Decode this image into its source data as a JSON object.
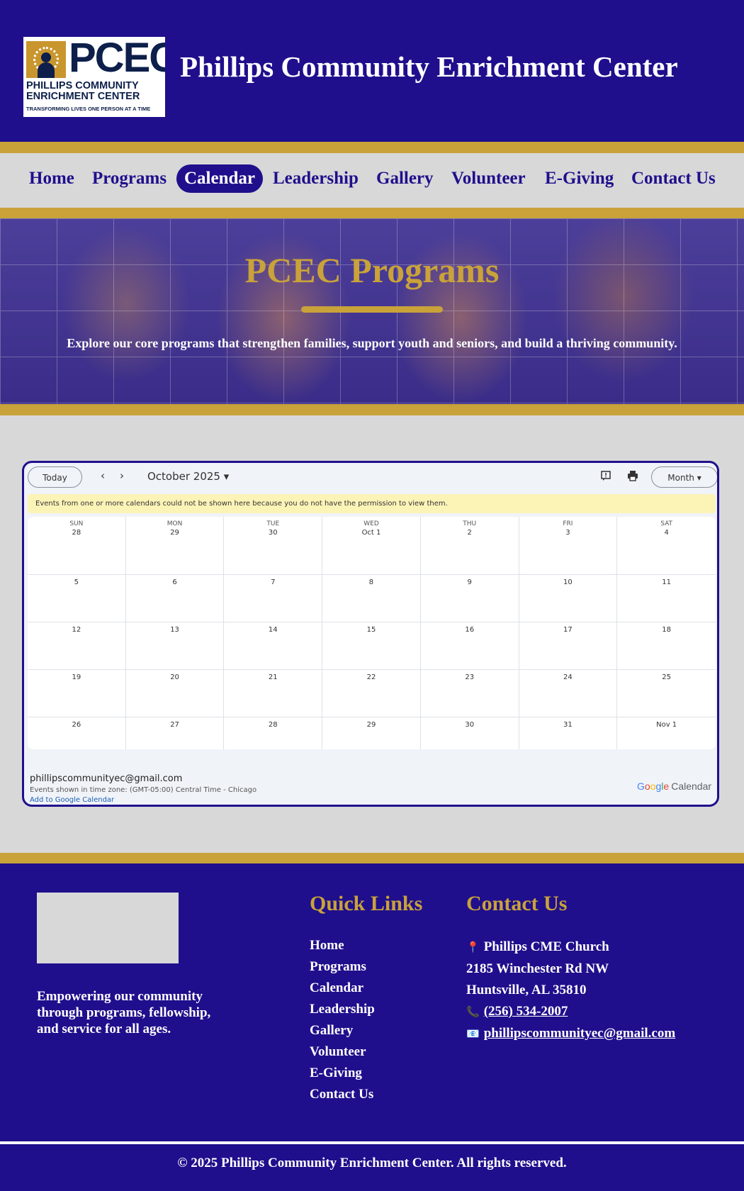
{
  "header": {
    "logo": {
      "big": "PCEC",
      "line1": "PHILLIPS COMMUNITY",
      "line2": "ENRICHMENT CENTER",
      "tagline": "TRANSFORMING LIVES ONE PERSON AT A TIME"
    },
    "title": "Phillips Community Enrichment Center"
  },
  "nav": {
    "items": [
      {
        "label": "Home"
      },
      {
        "label": "Programs"
      },
      {
        "label": "Calendar",
        "active": true
      },
      {
        "label": "Leadership"
      },
      {
        "label": "Gallery"
      },
      {
        "label": "Volunteer"
      },
      {
        "label": "E-Giving"
      },
      {
        "label": "Contact Us"
      }
    ]
  },
  "hero": {
    "title": "PCEC Programs",
    "subtitle": "Explore our core programs that strengthen families, support youth and seniors, and build a thriving community."
  },
  "calendar": {
    "today_label": "Today",
    "prev_icon": "‹",
    "next_icon": "›",
    "month_label": "October 2025 ▾",
    "view_label": "Month ▾",
    "warning": "Events from one or more calendars could not be shown here because you do not have the permission to view them.",
    "weekdays": [
      "SUN",
      "MON",
      "TUE",
      "WED",
      "THU",
      "FRI",
      "SAT"
    ],
    "dates": [
      "28",
      "29",
      "30",
      "Oct 1",
      "2",
      "3",
      "4",
      "5",
      "6",
      "7",
      "8",
      "9",
      "10",
      "11",
      "12",
      "13",
      "14",
      "15",
      "16",
      "17",
      "18",
      "19",
      "20",
      "21",
      "22",
      "23",
      "24",
      "25",
      "26",
      "27",
      "28",
      "29",
      "30",
      "31",
      "Nov 1"
    ],
    "owner_email": "phillipscommunityec@gmail.com",
    "timezone": "Events shown in time zone: (GMT-05:00) Central Time - Chicago",
    "add_link": "Add to Google Calendar",
    "brand_google": [
      "G",
      "o",
      "o",
      "g",
      "l",
      "e"
    ],
    "brand_calendar": "Calendar"
  },
  "footer": {
    "tagline": "Empowering our community through programs, fellowship, and service for all ages.",
    "quick_links_heading": "Quick Links",
    "quick_links": [
      "Home",
      "Programs",
      "Calendar",
      "Leadership",
      "Gallery",
      "Volunteer",
      "E-Giving",
      "Contact Us"
    ],
    "contact_heading": "Contact Us",
    "contact": {
      "pin_icon": "📍",
      "church": "Phillips CME Church",
      "street": "2185 Winchester Rd NW",
      "city": "Huntsville, AL 35810",
      "phone_icon": "📞",
      "phone": "(256) 534-2007",
      "email_icon": "📧",
      "email": "phillipscommunityec@gmail.com"
    },
    "copyright": "© 2025 Phillips Community Enrichment Center. All rights reserved."
  },
  "colors": {
    "primary": "#1f0f8c",
    "gold": "#c9a23a",
    "background": "#d8d8d8"
  }
}
